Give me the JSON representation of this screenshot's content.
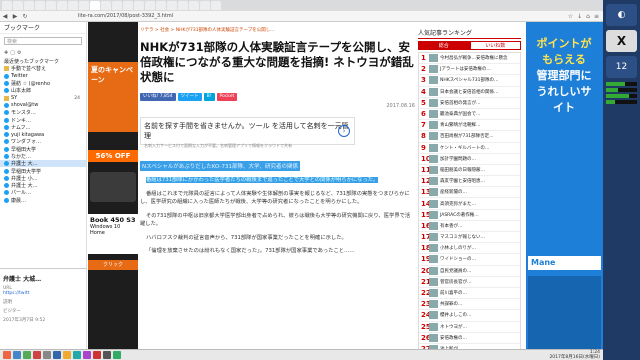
{
  "browser": {
    "url": "lite-ra.com/2017/08/post-3392_3.html"
  },
  "sidebar": {
    "title": "ブックマーク",
    "search_placeholder": "検索",
    "section_label": "最近使ったブックマーク",
    "items": [
      {
        "label": "手動で並べ替え",
        "icon": "folder",
        "count": ""
      },
      {
        "label": "Twitter",
        "icon": "twitter",
        "count": ""
      },
      {
        "label": "蓮舫 ☆ (@renho",
        "icon": "twitter",
        "count": ""
      },
      {
        "label": "山本太郎",
        "icon": "twitter",
        "count": ""
      },
      {
        "label": "SY",
        "icon": "folder",
        "count": "24"
      },
      {
        "label": "shoval@tw",
        "icon": "twitter",
        "count": ""
      },
      {
        "label": "モンスタ…",
        "icon": "twitter",
        "count": ""
      },
      {
        "label": "ドンキ…",
        "icon": "twitter",
        "count": ""
      },
      {
        "label": "ナムフ…",
        "icon": "twitter",
        "count": ""
      },
      {
        "label": "yuji kitagawa",
        "icon": "twitter",
        "count": ""
      },
      {
        "label": "ワンダフォ…",
        "icon": "twitter",
        "count": ""
      },
      {
        "label": "早稲田大学",
        "icon": "twitter",
        "count": ""
      },
      {
        "label": "なかだ…",
        "icon": "twitter",
        "count": ""
      },
      {
        "label": "弁護士 大…",
        "icon": "twitter",
        "count": ""
      },
      {
        "label": "早稲田大学学",
        "icon": "twitter",
        "count": ""
      },
      {
        "label": "弁護士 小…",
        "icon": "twitter",
        "count": ""
      },
      {
        "label": "弁護士 大…",
        "icon": "twitter",
        "count": ""
      },
      {
        "label": "パール…",
        "icon": "twitter",
        "count": ""
      },
      {
        "label": "康晨…",
        "icon": "twitter",
        "count": ""
      }
    ],
    "detail": {
      "title": "弁護士 大城…",
      "url_label": "URL",
      "url_value": "https://twitt",
      "desc_label": "説明",
      "date_label": "ビジター",
      "date_value": "2017年3月7日 9:52"
    }
  },
  "page": {
    "breadcrumb": "リテラ > 社会 > NHKが731部隊の人体実験証言テープを公開し…",
    "title": "NHKが731部隊の人体実験証言テープを公開し、安倍政権につながる重大な問題を指摘! ネトウヨが錯乱状態に",
    "social": {
      "like": "いいね! 7,854",
      "tweet": "ツイート",
      "hatena": "B!",
      "pocket": "Pocket"
    },
    "date": "2017.08.16",
    "ad": {
      "headline": "名前を探す手間を省きませんか。ツール を活用して名刺を一元管理",
      "sub": "名刺入力サービス付で面倒な入力が不要。名刺管理アプリで情報をクラウドで共有",
      "go": "›"
    },
    "lead_highlight": "NスペシャルがあぶりだしたKO-731部隊、大学、研究者の関係",
    "paragraphs": [
      "番組は731部隊にかかわった医学者たちの戦後まで追ったことで大学との関係が明らかになった。",
      "番組はこれまで元隊員の証言によって人体実験や生体解剖の事実を報じるなど、731部隊の実態をつまびらかにし、医学研究の組織に入った医師たちが戦後、大学等の研究者になったことを明らかにした。",
      "その731部隊の中枢は旧京都大学医学部出身者で占められ、彼らは戦後も大学等の研究機関に戻り、医学界で活躍した。",
      "ハバロフスク裁判の証言音声から、731部隊が国家事業だったことを明確に示した。",
      "「倫理を放棄させたのは紛れもなく国家だった」。731部隊が国家事業であったこと……"
    ]
  },
  "ranking": {
    "title": "人気記事ランキング",
    "tabs": [
      "総合",
      "いいね数"
    ],
    "items": [
      {
        "num": "1",
        "text": "今村昌弘が戦争…安倍政権に懸念"
      },
      {
        "num": "2",
        "text": "Jアラートは安倍政権の…"
      },
      {
        "num": "3",
        "text": "NHKスペシャル731部隊の…"
      },
      {
        "num": "4",
        "text": "日本会議と安倍首相の関係…"
      },
      {
        "num": "5",
        "text": "安倍首相の発言が…"
      },
      {
        "num": "6",
        "text": "籠池泰典が国会で…"
      },
      {
        "num": "7",
        "text": "青山繁晴が北朝鮮…"
      },
      {
        "num": "8",
        "text": "百田尚樹が731部隊否定…"
      },
      {
        "num": "9",
        "text": "ケント・ギルバートの…"
      },
      {
        "num": "10",
        "text": "加計学園問題の…"
      },
      {
        "num": "11",
        "text": "稲田朋美の日報隠蔽…"
      },
      {
        "num": "12",
        "text": "森友学園と安倍昭恵…"
      },
      {
        "num": "13",
        "text": "産経新聞の…"
      },
      {
        "num": "14",
        "text": "高須克弥がまた…"
      },
      {
        "num": "15",
        "text": "JASRACの著作権…"
      },
      {
        "num": "16",
        "text": "有本香が…"
      },
      {
        "num": "17",
        "text": "マスコミが報じない…"
      },
      {
        "num": "18",
        "text": "小林よしのりが…"
      },
      {
        "num": "19",
        "text": "ワイドショーの…"
      },
      {
        "num": "20",
        "text": "自民党議員の…"
      },
      {
        "num": "21",
        "text": "菅官房長官が…"
      },
      {
        "num": "22",
        "text": "前川喜平の…"
      },
      {
        "num": "23",
        "text": "共謀罪の…"
      },
      {
        "num": "24",
        "text": "櫻井よしこの…"
      },
      {
        "num": "25",
        "text": "ネトウヨが…"
      },
      {
        "num": "26",
        "text": "安倍政権の…"
      },
      {
        "num": "27",
        "text": "池上彰が…"
      }
    ]
  },
  "ad_left": {
    "promo": "夏のキャンペーン",
    "discount": "56% OFF",
    "book": "Book 450 S3",
    "book_sub": "Windows 10 Home",
    "click": "クリック"
  },
  "ad_right": {
    "line1": "ポイントがもらえる",
    "line2": "管理部門にうれしいサイト",
    "mane": "Mane"
  },
  "status": {
    "time": "1:24",
    "date": "2017年8月16日(水曜日)"
  },
  "desktop": {
    "x_label": "X",
    "clock": "12"
  }
}
